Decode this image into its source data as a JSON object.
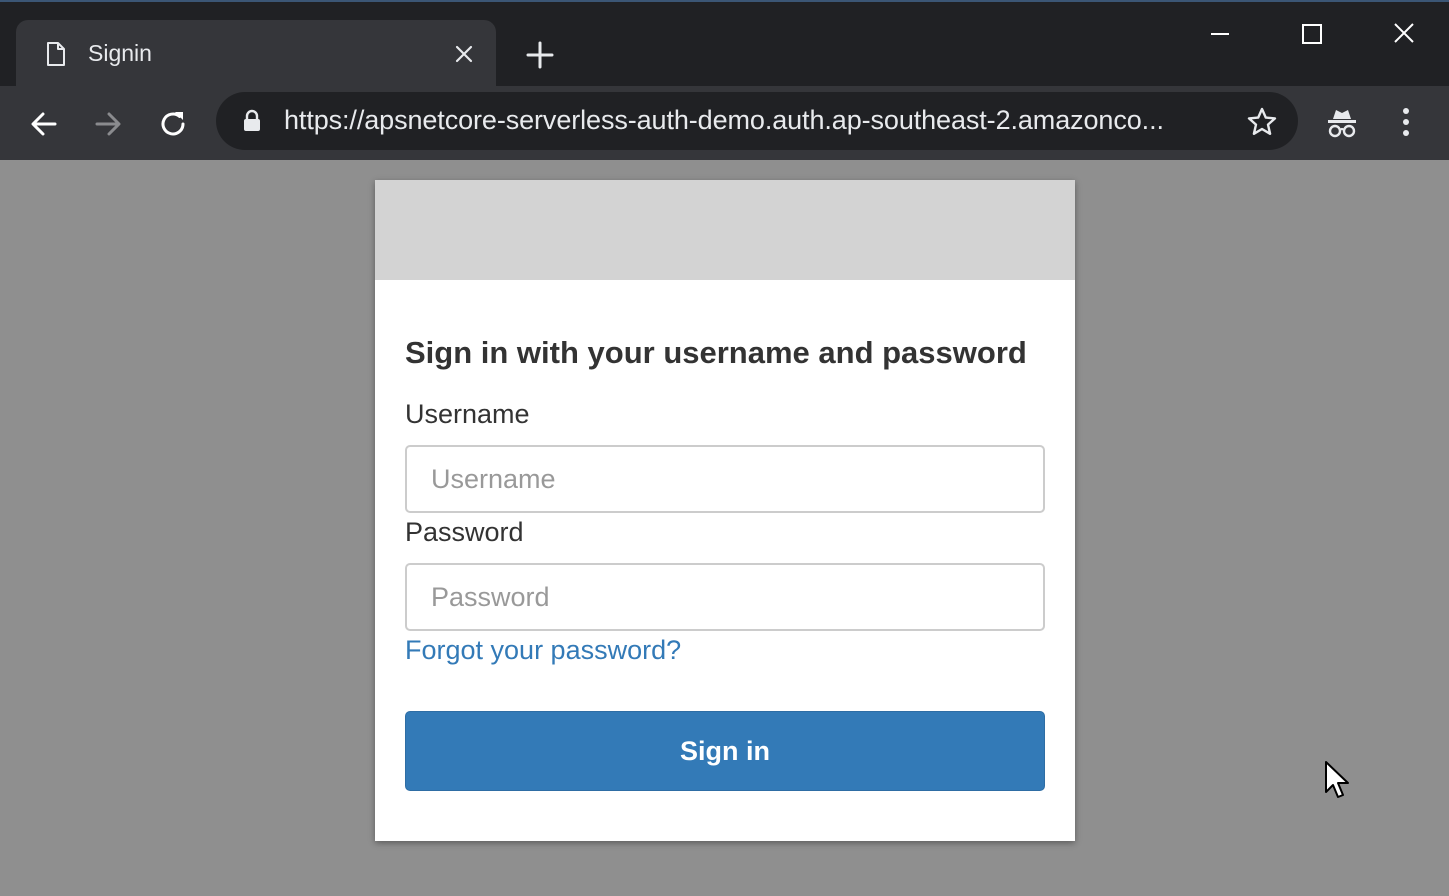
{
  "browser": {
    "tab": {
      "title": "Signin",
      "icon": "page-icon"
    },
    "address_bar": {
      "url": "https://apsnetcore-serverless-auth-demo.auth.ap-southeast-2.amazonco...",
      "secure_icon": "lock-icon"
    },
    "theme": {
      "frame": "#202124",
      "toolbar": "#35363a",
      "text": "#e8eaed"
    }
  },
  "page": {
    "background": "#8f8f8f",
    "form": {
      "heading": "Sign in with your username and password",
      "username": {
        "label": "Username",
        "placeholder": "Username",
        "value": ""
      },
      "password": {
        "label": "Password",
        "placeholder": "Password",
        "value": ""
      },
      "forgot_link": "Forgot your password?",
      "submit_label": "Sign in",
      "accent": "#337ab7"
    }
  }
}
